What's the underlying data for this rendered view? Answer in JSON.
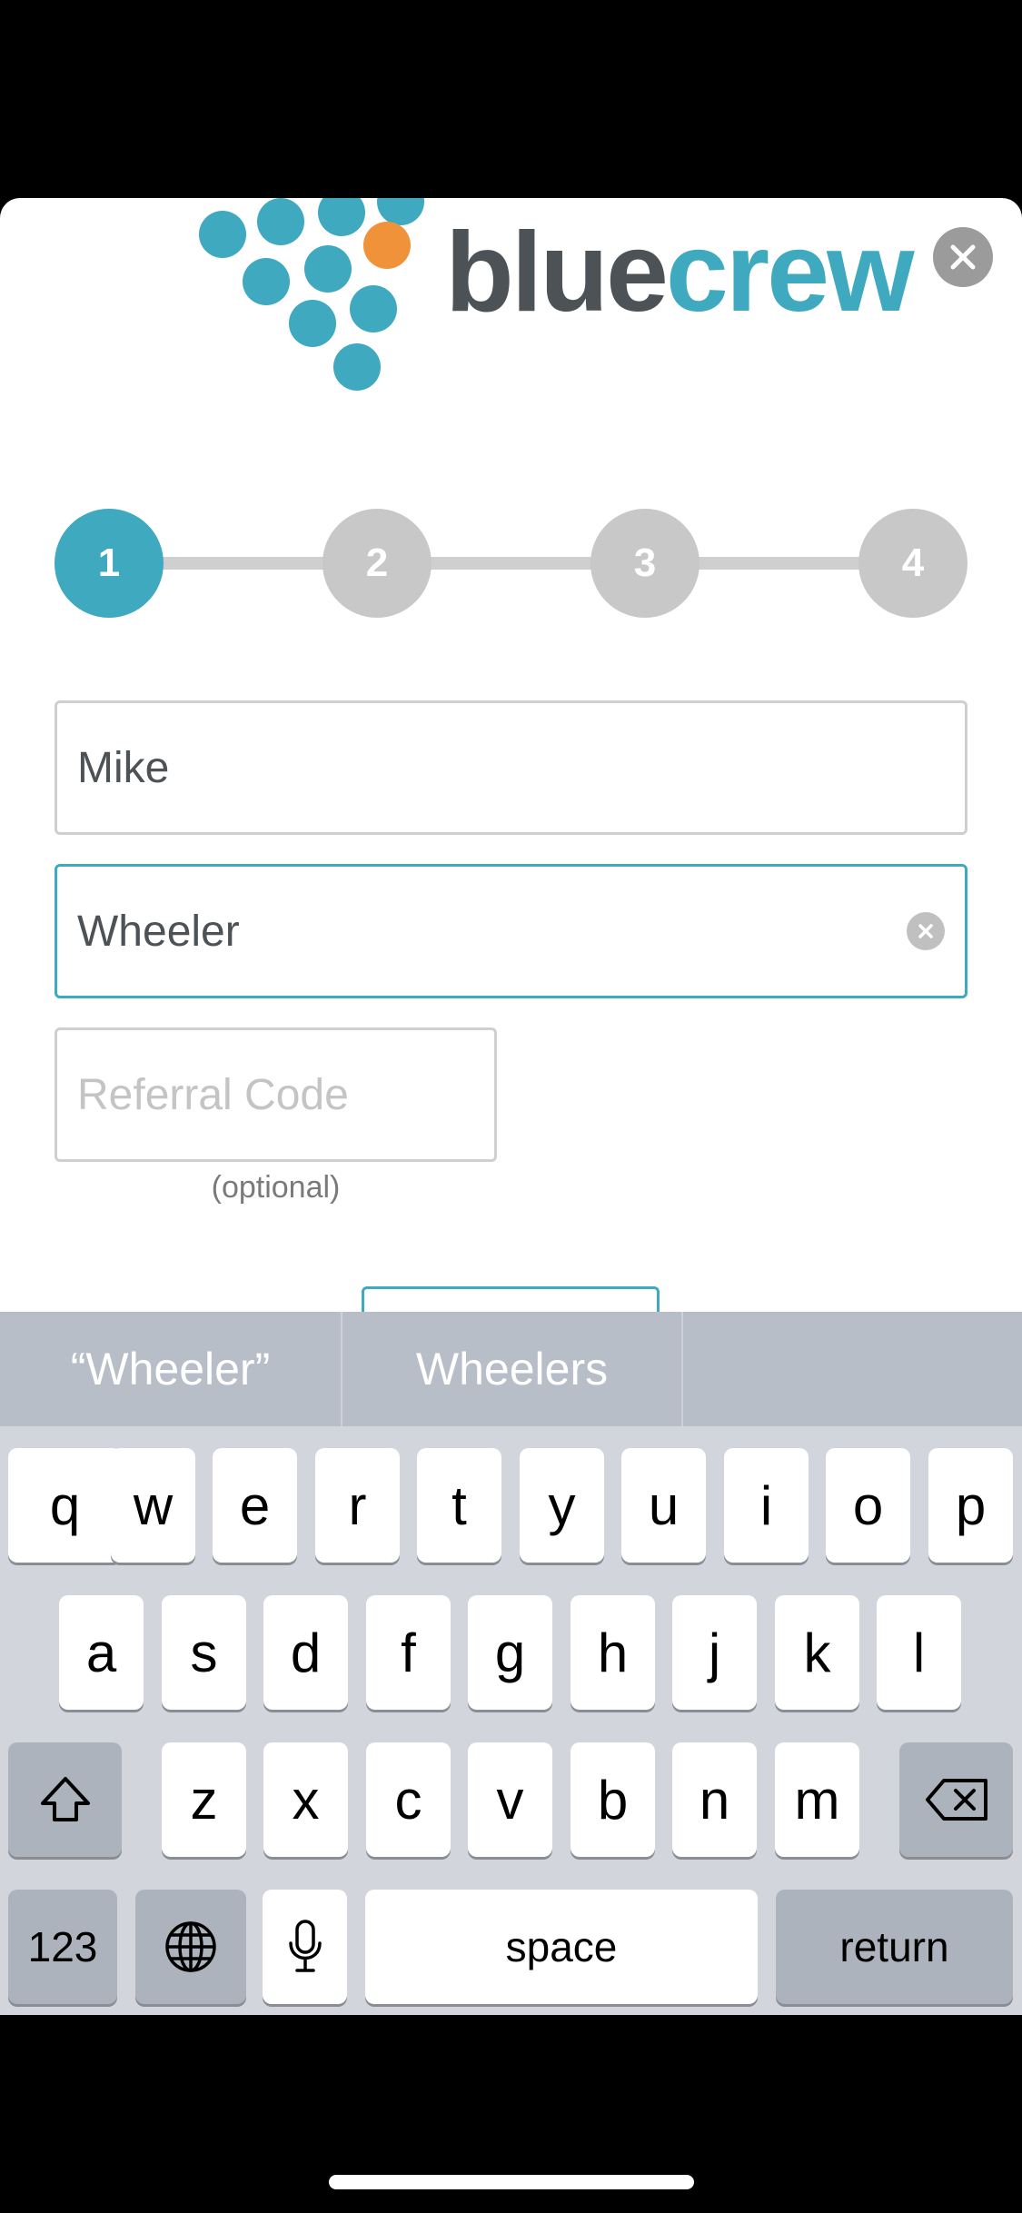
{
  "brand": {
    "word_part1": "blue",
    "word_part2": "crew",
    "colors": {
      "primary": "#3ea9bf",
      "accent": "#f0923a",
      "dark": "#4d5257"
    }
  },
  "close_button": {
    "icon": "close-icon"
  },
  "steps": [
    "1",
    "2",
    "3",
    "4"
  ],
  "active_step": "1",
  "form": {
    "first_name": {
      "value": "Mike"
    },
    "last_name": {
      "value": "Wheeler",
      "clear_icon": "clear-icon"
    },
    "referral": {
      "placeholder": "Referral Code",
      "hint": "(optional)"
    }
  },
  "keyboard": {
    "suggestions": [
      "“Wheeler”",
      "Wheelers",
      ""
    ],
    "row1": [
      "q",
      "w",
      "e",
      "r",
      "t",
      "y",
      "u",
      "i",
      "o",
      "p"
    ],
    "row2": [
      "a",
      "s",
      "d",
      "f",
      "g",
      "h",
      "j",
      "k",
      "l"
    ],
    "row3": [
      "z",
      "x",
      "c",
      "v",
      "b",
      "n",
      "m"
    ],
    "shift_icon": "shift-icon",
    "backspace_icon": "backspace-icon",
    "numbers_label": "123",
    "globe_icon": "globe-icon",
    "mic_icon": "microphone-icon",
    "space_label": "space",
    "return_label": "return"
  }
}
